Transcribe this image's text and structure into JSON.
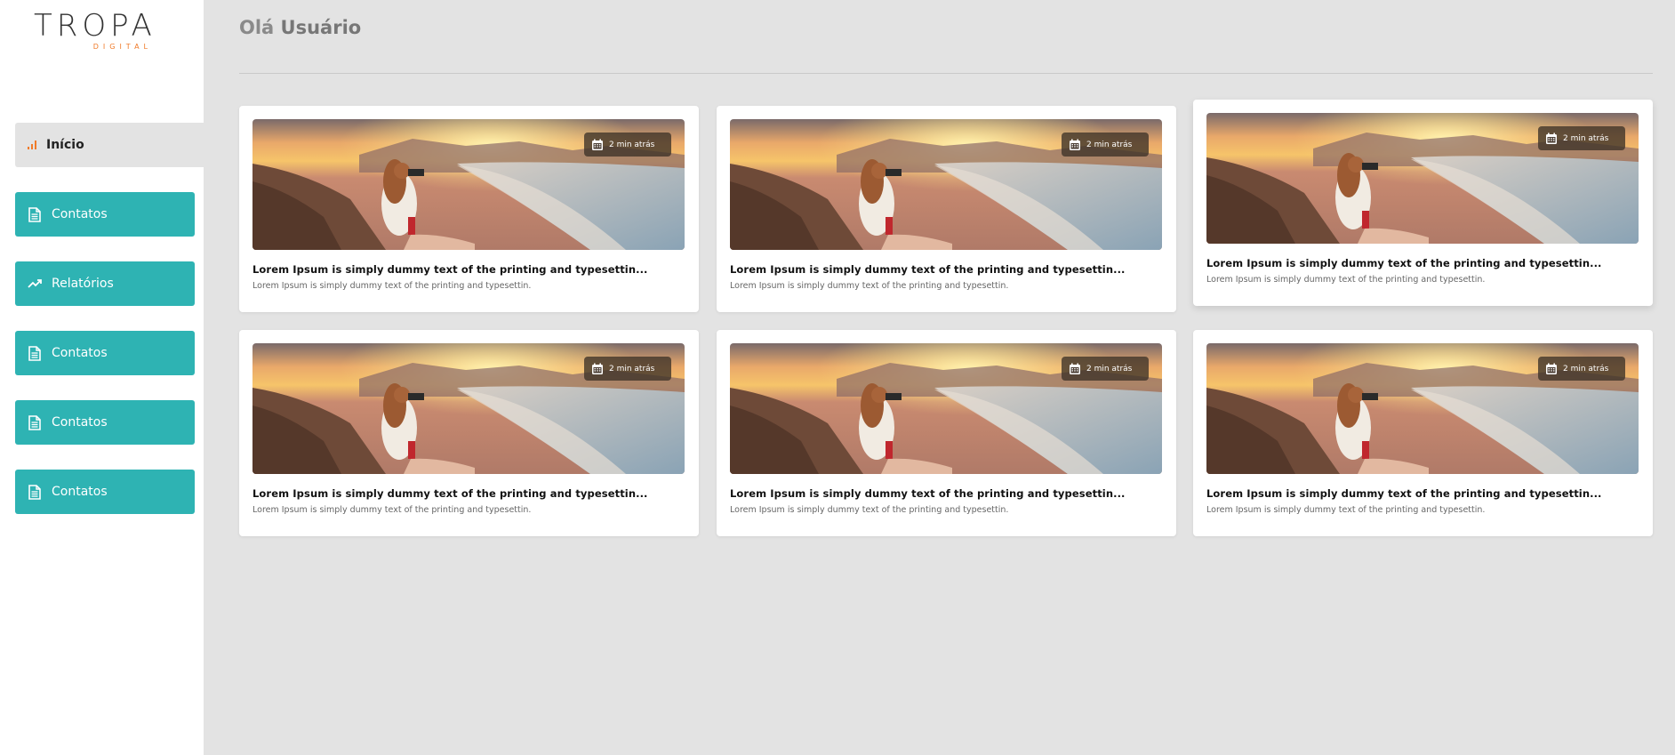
{
  "brand": {
    "logo_text": "TROPA",
    "logo_sub": "DIGITAL",
    "accent": "#f07b2a",
    "teal": "#2eb3b3"
  },
  "header": {
    "greeting": "Olá",
    "user": "Usuário"
  },
  "sidebar": {
    "items": [
      {
        "label": "Início",
        "icon": "bar-chart-icon",
        "active": true
      },
      {
        "label": "Contatos",
        "icon": "document-icon"
      },
      {
        "label": "Relatórios",
        "icon": "trending-up-icon"
      },
      {
        "label": "Contatos",
        "icon": "document-icon"
      },
      {
        "label": "Contatos",
        "icon": "document-icon"
      },
      {
        "label": "Contatos",
        "icon": "document-icon"
      }
    ]
  },
  "cards": [
    {
      "time": "2 min atrás",
      "title": "Lorem Ipsum is simply dummy text of the printing and typesettin...",
      "description": "Lorem Ipsum is simply dummy text of the printing and typesettin."
    },
    {
      "time": "2 min atrás",
      "title": "Lorem Ipsum is simply dummy text of the printing and typesettin...",
      "description": "Lorem Ipsum is simply dummy text of the printing and typesettin."
    },
    {
      "time": "2 min atrás",
      "title": "Lorem Ipsum is simply dummy text of the printing and typesettin...",
      "description": "Lorem Ipsum is simply dummy text of the printing and typesettin."
    },
    {
      "time": "2 min atrás",
      "title": "Lorem Ipsum is simply dummy text of the printing and typesettin...",
      "description": "Lorem Ipsum is simply dummy text of the printing and typesettin."
    },
    {
      "time": "2 min atrás",
      "title": "Lorem Ipsum is simply dummy text of the printing and typesettin...",
      "description": "Lorem Ipsum is simply dummy text of the printing and typesettin."
    },
    {
      "time": "2 min atrás",
      "title": "Lorem Ipsum is simply dummy text of the printing and typesettin...",
      "description": "Lorem Ipsum is simply dummy text of the printing and typesettin."
    }
  ]
}
